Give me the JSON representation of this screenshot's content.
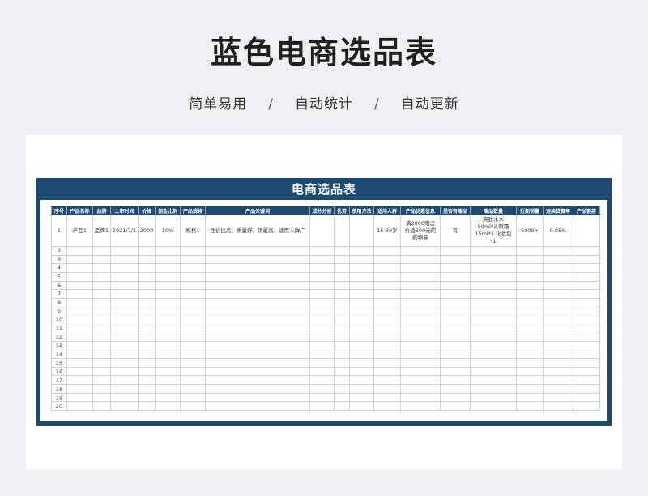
{
  "title": "蓝色电商选品表",
  "subtitle": {
    "items": [
      "简单易用",
      "自动统计",
      "自动更新"
    ],
    "separator": "/"
  },
  "sheet": {
    "header_title": "电商选品表",
    "header_color": "#1e4a72",
    "columns": [
      "序号",
      "产品名称",
      "品牌",
      "上市时间",
      "价格",
      "佣金比例",
      "产品规格",
      "产品关键词",
      "成分分析",
      "优势",
      "使用方法",
      "适用人群",
      "产品优惠信息",
      "是否有赠品",
      "赠品数量",
      "近期销量",
      "退换货概率",
      "产品链接"
    ],
    "first_row": {
      "index": "1",
      "product_name": "产品1",
      "brand": "品牌1",
      "launch_date": "2021/7/1",
      "price": "2000",
      "commission": "10%",
      "spec": "规格1",
      "keywords": "性价比高、质量好、销量高、适用人群广",
      "ingredients": "",
      "advantage": "",
      "usage": "",
      "audience": "15-60岁",
      "promotion": "满2000赠送价值500元的购物卷",
      "has_gift": "有",
      "gift_qty": "爽肤水水 50ml*2 眼霜15ml*1 化妆包*1",
      "sales": "5000+",
      "return_rate": "0.05%",
      "link": ""
    },
    "empty_rows": [
      "2",
      "3",
      "4",
      "5",
      "6",
      "7",
      "8",
      "9",
      "10",
      "11",
      "12",
      "13",
      "14",
      "15",
      "16",
      "17",
      "18",
      "19",
      "20"
    ]
  }
}
